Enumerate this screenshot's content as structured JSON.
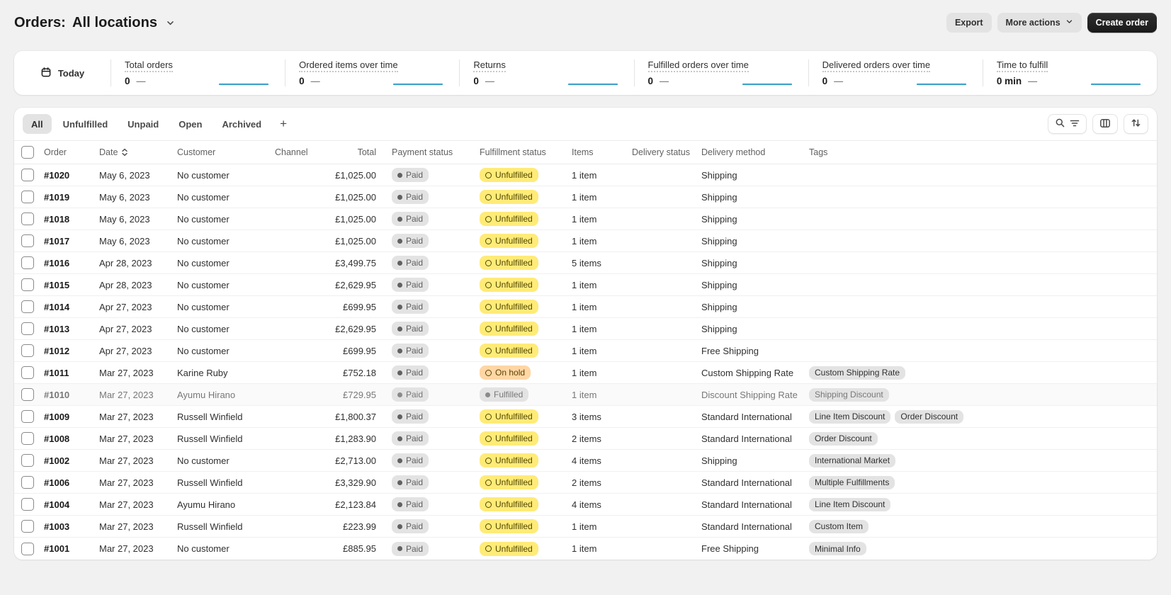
{
  "page": {
    "title_prefix": "Orders:",
    "title_location": "All locations"
  },
  "header_actions": {
    "export": "Export",
    "more_actions": "More actions",
    "create_order": "Create order"
  },
  "icons": {
    "title_disclosure": "chevron-down-icon",
    "more_actions_disclosure": "chevron-down-icon",
    "date_range": "calendar-icon",
    "search_filter": "search-and-filter-icon",
    "columns": "columns-icon",
    "sort": "sort-arrows-icon",
    "date_sort": "sort-chevrons-icon",
    "add_view": "plus-icon",
    "paid_status": "filled-dot-icon",
    "unfulfilled_status": "open-circle-icon"
  },
  "colors": {
    "page_bg": "#f1f1f1",
    "card_bg": "#ffffff",
    "sparkline": "#42a1c9",
    "badge_attention_bg": "#ffeb78",
    "badge_caution_bg": "#ffd6a4",
    "badge_neutral_bg": "#e3e3e3",
    "primary_button_bg": "#1a1a1a"
  },
  "metrics": {
    "date_range": "Today",
    "items": [
      {
        "label": "Total orders",
        "value": "0",
        "delta": "—"
      },
      {
        "label": "Ordered items over time",
        "value": "0",
        "delta": "—"
      },
      {
        "label": "Returns",
        "value": "0",
        "delta": "—"
      },
      {
        "label": "Fulfilled orders over time",
        "value": "0",
        "delta": "—"
      },
      {
        "label": "Delivered orders over time",
        "value": "0",
        "delta": "—"
      },
      {
        "label": "Time to fulfill",
        "value": "0 min",
        "delta": "—"
      }
    ]
  },
  "tabs": {
    "items": [
      "All",
      "Unfulfilled",
      "Unpaid",
      "Open",
      "Archived"
    ],
    "active": "All",
    "add_label": "+"
  },
  "table": {
    "columns": [
      {
        "key": "select",
        "label": ""
      },
      {
        "key": "order",
        "label": "Order"
      },
      {
        "key": "date",
        "label": "Date",
        "sortable": true
      },
      {
        "key": "customer",
        "label": "Customer"
      },
      {
        "key": "channel",
        "label": "Channel"
      },
      {
        "key": "total",
        "label": "Total"
      },
      {
        "key": "payment",
        "label": "Payment status"
      },
      {
        "key": "fulfillment",
        "label": "Fulfillment status"
      },
      {
        "key": "items",
        "label": "Items"
      },
      {
        "key": "dstatus",
        "label": "Delivery status"
      },
      {
        "key": "dmethod",
        "label": "Delivery method"
      },
      {
        "key": "tags",
        "label": "Tags"
      }
    ],
    "rows": [
      {
        "order": "#1020",
        "date": "May 6, 2023",
        "customer": "No customer",
        "channel": "",
        "total": "£1,025.00",
        "payment_status": "Paid",
        "fulfillment_status": "Unfulfilled",
        "fulfillment_tone": "attention",
        "items": "1 item",
        "delivery_status": "",
        "delivery_method": "Shipping",
        "tags": [],
        "subdued": false
      },
      {
        "order": "#1019",
        "date": "May 6, 2023",
        "customer": "No customer",
        "channel": "",
        "total": "£1,025.00",
        "payment_status": "Paid",
        "fulfillment_status": "Unfulfilled",
        "fulfillment_tone": "attention",
        "items": "1 item",
        "delivery_status": "",
        "delivery_method": "Shipping",
        "tags": [],
        "subdued": false
      },
      {
        "order": "#1018",
        "date": "May 6, 2023",
        "customer": "No customer",
        "channel": "",
        "total": "£1,025.00",
        "payment_status": "Paid",
        "fulfillment_status": "Unfulfilled",
        "fulfillment_tone": "attention",
        "items": "1 item",
        "delivery_status": "",
        "delivery_method": "Shipping",
        "tags": [],
        "subdued": false
      },
      {
        "order": "#1017",
        "date": "May 6, 2023",
        "customer": "No customer",
        "channel": "",
        "total": "£1,025.00",
        "payment_status": "Paid",
        "fulfillment_status": "Unfulfilled",
        "fulfillment_tone": "attention",
        "items": "1 item",
        "delivery_status": "",
        "delivery_method": "Shipping",
        "tags": [],
        "subdued": false
      },
      {
        "order": "#1016",
        "date": "Apr 28, 2023",
        "customer": "No customer",
        "channel": "",
        "total": "£3,499.75",
        "payment_status": "Paid",
        "fulfillment_status": "Unfulfilled",
        "fulfillment_tone": "attention",
        "items": "5 items",
        "delivery_status": "",
        "delivery_method": "Shipping",
        "tags": [],
        "subdued": false
      },
      {
        "order": "#1015",
        "date": "Apr 28, 2023",
        "customer": "No customer",
        "channel": "",
        "total": "£2,629.95",
        "payment_status": "Paid",
        "fulfillment_status": "Unfulfilled",
        "fulfillment_tone": "attention",
        "items": "1 item",
        "delivery_status": "",
        "delivery_method": "Shipping",
        "tags": [],
        "subdued": false
      },
      {
        "order": "#1014",
        "date": "Apr 27, 2023",
        "customer": "No customer",
        "channel": "",
        "total": "£699.95",
        "payment_status": "Paid",
        "fulfillment_status": "Unfulfilled",
        "fulfillment_tone": "attention",
        "items": "1 item",
        "delivery_status": "",
        "delivery_method": "Shipping",
        "tags": [],
        "subdued": false
      },
      {
        "order": "#1013",
        "date": "Apr 27, 2023",
        "customer": "No customer",
        "channel": "",
        "total": "£2,629.95",
        "payment_status": "Paid",
        "fulfillment_status": "Unfulfilled",
        "fulfillment_tone": "attention",
        "items": "1 item",
        "delivery_status": "",
        "delivery_method": "Shipping",
        "tags": [],
        "subdued": false
      },
      {
        "order": "#1012",
        "date": "Apr 27, 2023",
        "customer": "No customer",
        "channel": "",
        "total": "£699.95",
        "payment_status": "Paid",
        "fulfillment_status": "Unfulfilled",
        "fulfillment_tone": "attention",
        "items": "1 item",
        "delivery_status": "",
        "delivery_method": "Free Shipping",
        "tags": [],
        "subdued": false
      },
      {
        "order": "#1011",
        "date": "Mar 27, 2023",
        "customer": "Karine Ruby",
        "channel": "",
        "total": "£752.18",
        "payment_status": "Paid",
        "fulfillment_status": "On hold",
        "fulfillment_tone": "caution",
        "items": "1 item",
        "delivery_status": "",
        "delivery_method": "Custom Shipping Rate",
        "tags": [
          "Custom Shipping Rate"
        ],
        "subdued": false
      },
      {
        "order": "#1010",
        "date": "Mar 27, 2023",
        "customer": "Ayumu Hirano",
        "channel": "",
        "total": "£729.95",
        "payment_status": "Paid",
        "fulfillment_status": "Fulfilled",
        "fulfillment_tone": "complete",
        "items": "1 item",
        "delivery_status": "",
        "delivery_method": "Discount Shipping Rate",
        "tags": [
          "Shipping Discount"
        ],
        "subdued": true
      },
      {
        "order": "#1009",
        "date": "Mar 27, 2023",
        "customer": "Russell Winfield",
        "channel": "",
        "total": "£1,800.37",
        "payment_status": "Paid",
        "fulfillment_status": "Unfulfilled",
        "fulfillment_tone": "attention",
        "items": "3 items",
        "delivery_status": "",
        "delivery_method": "Standard International",
        "tags": [
          "Line Item Discount",
          "Order Discount"
        ],
        "subdued": false
      },
      {
        "order": "#1008",
        "date": "Mar 27, 2023",
        "customer": "Russell Winfield",
        "channel": "",
        "total": "£1,283.90",
        "payment_status": "Paid",
        "fulfillment_status": "Unfulfilled",
        "fulfillment_tone": "attention",
        "items": "2 items",
        "delivery_status": "",
        "delivery_method": "Standard International",
        "tags": [
          "Order Discount"
        ],
        "subdued": false
      },
      {
        "order": "#1002",
        "date": "Mar 27, 2023",
        "customer": "No customer",
        "channel": "",
        "total": "£2,713.00",
        "payment_status": "Paid",
        "fulfillment_status": "Unfulfilled",
        "fulfillment_tone": "attention",
        "items": "4 items",
        "delivery_status": "",
        "delivery_method": "Shipping",
        "tags": [
          "International Market"
        ],
        "subdued": false
      },
      {
        "order": "#1006",
        "date": "Mar 27, 2023",
        "customer": "Russell Winfield",
        "channel": "",
        "total": "£3,329.90",
        "payment_status": "Paid",
        "fulfillment_status": "Unfulfilled",
        "fulfillment_tone": "attention",
        "items": "2 items",
        "delivery_status": "",
        "delivery_method": "Standard International",
        "tags": [
          "Multiple Fulfillments"
        ],
        "subdued": false
      },
      {
        "order": "#1004",
        "date": "Mar 27, 2023",
        "customer": "Ayumu Hirano",
        "channel": "",
        "total": "£2,123.84",
        "payment_status": "Paid",
        "fulfillment_status": "Unfulfilled",
        "fulfillment_tone": "attention",
        "items": "4 items",
        "delivery_status": "",
        "delivery_method": "Standard International",
        "tags": [
          "Line Item Discount"
        ],
        "subdued": false
      },
      {
        "order": "#1003",
        "date": "Mar 27, 2023",
        "customer": "Russell Winfield",
        "channel": "",
        "total": "£223.99",
        "payment_status": "Paid",
        "fulfillment_status": "Unfulfilled",
        "fulfillment_tone": "attention",
        "items": "1 item",
        "delivery_status": "",
        "delivery_method": "Standard International",
        "tags": [
          "Custom Item"
        ],
        "subdued": false
      },
      {
        "order": "#1001",
        "date": "Mar 27, 2023",
        "customer": "No customer",
        "channel": "",
        "total": "£885.95",
        "payment_status": "Paid",
        "fulfillment_status": "Unfulfilled",
        "fulfillment_tone": "attention",
        "items": "1 item",
        "delivery_status": "",
        "delivery_method": "Free Shipping",
        "tags": [
          "Minimal Info"
        ],
        "subdued": false
      }
    ]
  }
}
